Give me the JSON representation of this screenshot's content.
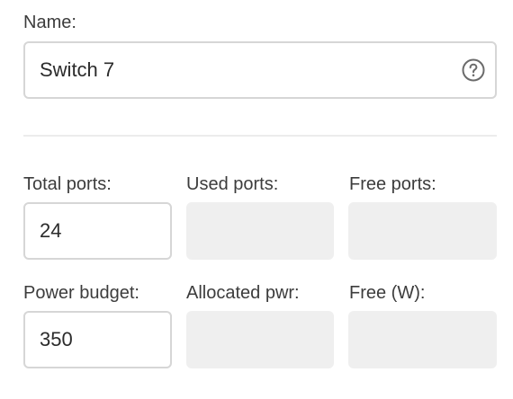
{
  "name_section": {
    "label": "Name:",
    "value": "Switch 7",
    "help_icon": "question-circle-icon"
  },
  "ports_section": {
    "total_label": "Total ports:",
    "total_value": "24",
    "used_label": "Used ports:",
    "used_value": "",
    "free_label": "Free ports:",
    "free_value": ""
  },
  "power_section": {
    "budget_label": "Power budget:",
    "budget_value": "350",
    "allocated_label": "Allocated pwr:",
    "allocated_value": "",
    "free_label": "Free (W):",
    "free_value": ""
  },
  "colors": {
    "border": "#d6d6d6",
    "readonly_bg": "#efefef",
    "divider": "#ececec"
  }
}
